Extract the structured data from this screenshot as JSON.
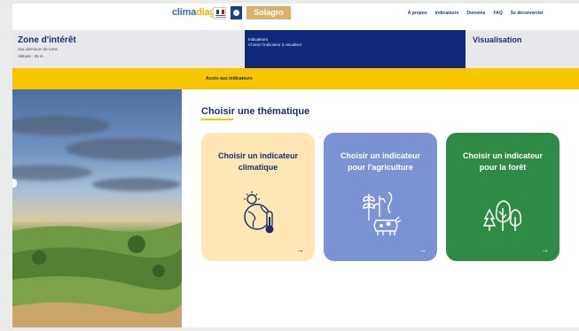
{
  "topbar": {
    "logo_text_main": "clima",
    "logo_text_accent": "diag",
    "partner_logo": "Solagro",
    "nav": [
      "À propos",
      "Indicateurs",
      "Données",
      "FAQ",
      "Se déconnecter"
    ]
  },
  "zone": {
    "title": "Zone d'intérêt",
    "line1": "Aux alentours de Lens",
    "line2": "Altitude : 25 m"
  },
  "steps": {
    "current_line1": "Indicateurs",
    "current_line2": "Choisir l'indicateur à visualiser",
    "next_title": "Visualisation"
  },
  "band": {
    "link_label": "Accès aux indicateurs"
  },
  "main": {
    "heading": "Choisir une thématique",
    "cards": [
      {
        "title": "Choisir un indicateur climatique",
        "icon": "climate-globe-thermometer-icon",
        "arrow": "→"
      },
      {
        "title": "Choisir un indicateur pour l'agriculture",
        "icon": "agriculture-crops-cow-icon",
        "arrow": "→"
      },
      {
        "title": "Choisir un indicateur pour la forêt",
        "icon": "forest-trees-icon",
        "arrow": "→"
      }
    ]
  },
  "colors": {
    "navy": "#1a2e6c",
    "header_active": "#11297a",
    "yellow": "#f7c600",
    "card_climate": "#fde8b5",
    "card_agriculture": "#7b93d3",
    "card_forest": "#2f8a45"
  }
}
